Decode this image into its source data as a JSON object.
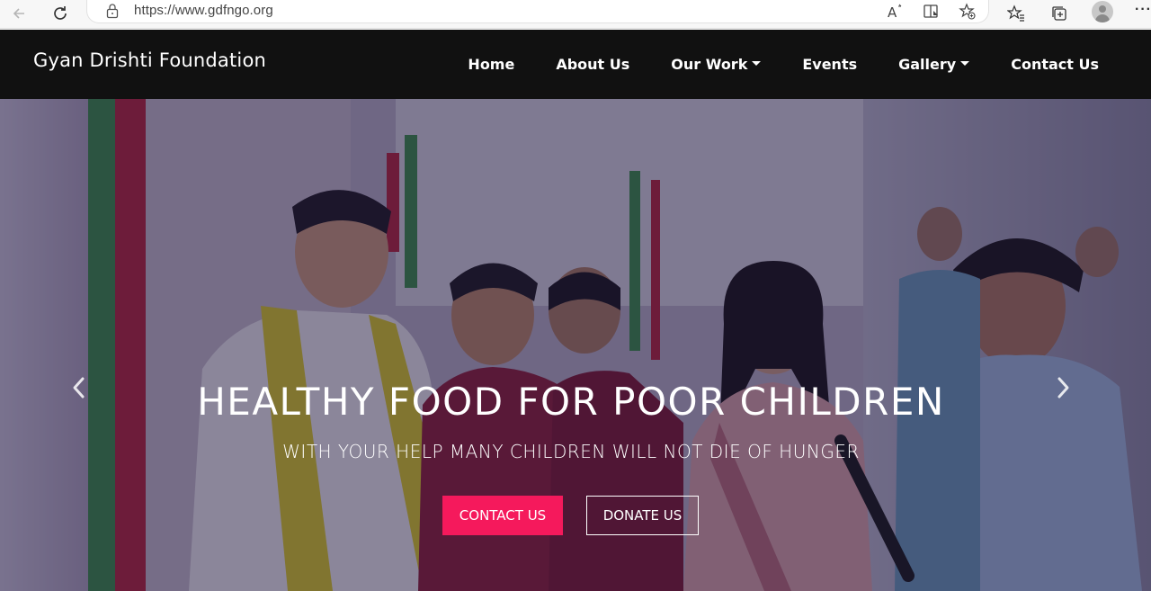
{
  "browser": {
    "url": "https://www.gdfngo.org",
    "read_aloud_label": "A͠"
  },
  "site": {
    "brand": "Gyan Drishti Foundation",
    "menu": [
      {
        "label": "Home",
        "has_dropdown": false
      },
      {
        "label": "About Us",
        "has_dropdown": false
      },
      {
        "label": "Our Work",
        "has_dropdown": true
      },
      {
        "label": "Events",
        "has_dropdown": false
      },
      {
        "label": "Gallery",
        "has_dropdown": true
      },
      {
        "label": "Contact Us",
        "has_dropdown": false
      }
    ]
  },
  "hero": {
    "title": "HEALTHY FOOD FOR POOR CHILDREN",
    "subtitle": "WITH YOUR HELP MANY CHILDREN WILL NOT DIE OF HUNGER",
    "primary_button": "CONTACT US",
    "secondary_button": "DONATE US"
  },
  "colors": {
    "navbar_bg": "#111111",
    "accent": "#f5195c"
  }
}
